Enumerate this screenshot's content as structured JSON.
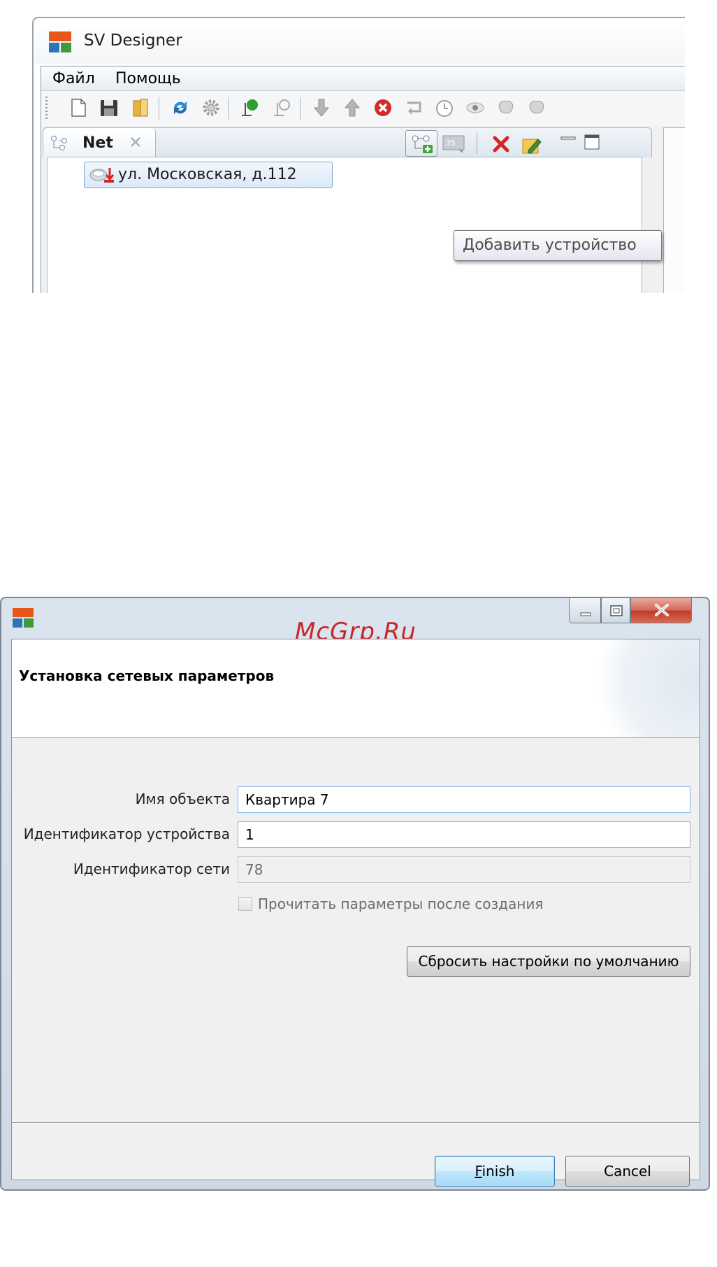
{
  "main_window": {
    "title": "SV Designer",
    "menu": [
      "Файл",
      "Помощь"
    ],
    "toolbar_icons": [
      "new-file-icon",
      "save-icon",
      "open-folder-icon",
      "refresh-icon",
      "settings-gear-icon",
      "connect-icon",
      "disconnect-icon",
      "download-icon",
      "upload-icon",
      "stop-error-icon",
      "loop-icon",
      "clock-icon",
      "eye-icon",
      "brain-icon"
    ],
    "view": {
      "tab_label": "Net",
      "view_icons": [
        "add-device-icon",
        "code-icon",
        "delete-icon",
        "edit-icon",
        "minimize-icon",
        "maximize-icon"
      ],
      "tree_item": "ул. Московская, д.112",
      "tooltip": "Добавить устройство"
    }
  },
  "watermark": "McGrp.Ru",
  "dialog": {
    "header_title": "Установка сетевых параметров",
    "fields": [
      {
        "label": "Имя объекта",
        "value": "Квартира 7"
      },
      {
        "label": "Идентификатор устройства",
        "value": "1"
      },
      {
        "label": "Идентификатор сети",
        "value": "78"
      }
    ],
    "checkbox_label": "Прочитать параметры после создания",
    "reset_button": "Сбросить настройки по умолчанию",
    "finish_mnemonic": "F",
    "finish_rest": "inish",
    "cancel_button": "Cancel"
  },
  "colors": {
    "logo_orange": "#e8561a",
    "logo_blue": "#2f74b5",
    "logo_green": "#3e9a3e",
    "close_red": "#c9463d"
  }
}
